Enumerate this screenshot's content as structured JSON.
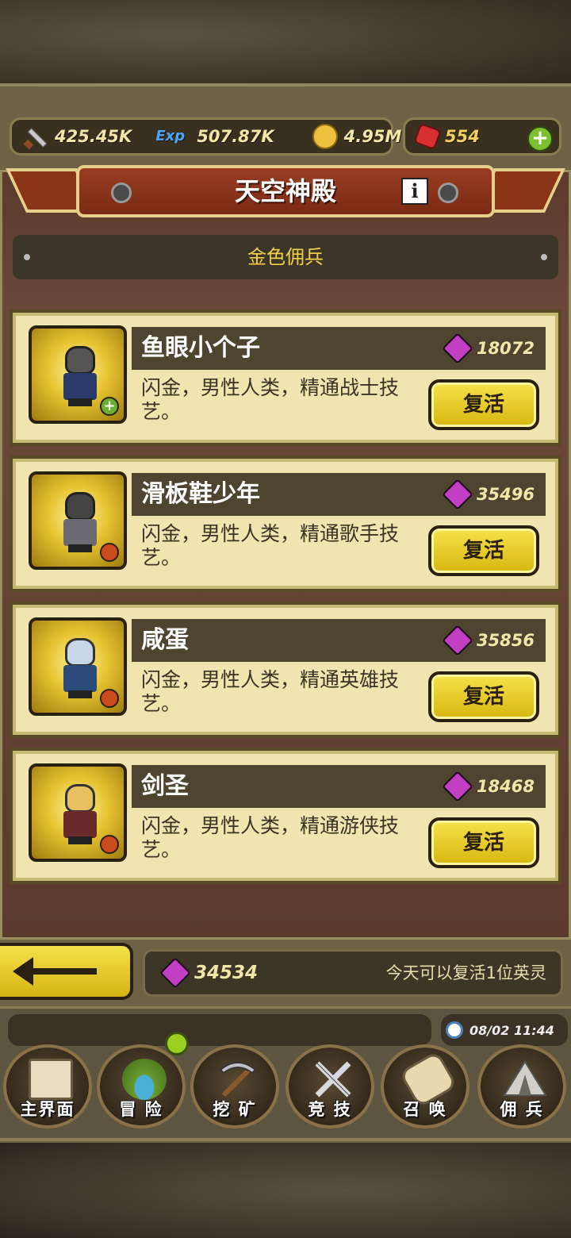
{
  "resources": {
    "attack": "425.45K",
    "exp_label": "Exp",
    "exp": "507.87K",
    "gold": "4.95M",
    "rubies": "554"
  },
  "header": {
    "title": "天空神殿",
    "info_label": "i",
    "subtitle": "金色佣兵"
  },
  "heroes": [
    {
      "name": "鱼眼小个子",
      "cost": "18072",
      "desc": "闪金，男性人类，精通战士技艺。",
      "button": "复活",
      "badge": "+"
    },
    {
      "name": "滑板鞋少年",
      "cost": "35496",
      "desc": "闪金，男性人类，精通歌手技艺。",
      "button": "复活",
      "badge": ""
    },
    {
      "name": "咸蛋",
      "cost": "35856",
      "desc": "闪金，男性人类，精通英雄技艺。",
      "button": "复活",
      "badge": ""
    },
    {
      "name": "剑圣",
      "cost": "18468",
      "desc": "闪金，男性人类，精通游侠技艺。",
      "button": "复活",
      "badge": ""
    }
  ],
  "footer": {
    "balance": "34534",
    "revive_note": "今天可以复活1位英灵"
  },
  "status": {
    "datetime": "08/02 11:44"
  },
  "nav": [
    {
      "label": "主界面",
      "icon": "map-scroll-icon"
    },
    {
      "label": "冒 险",
      "icon": "island-icon"
    },
    {
      "label": "挖 矿",
      "icon": "pickaxe-icon"
    },
    {
      "label": "竞 技",
      "icon": "crossed-swords-icon"
    },
    {
      "label": "召 唤",
      "icon": "summon-scroll-icon"
    },
    {
      "label": "佣 兵",
      "icon": "tent-icon"
    }
  ],
  "colors": {
    "accent_yellow": "#f0d048",
    "card_bg": "#f0e5b0",
    "gem_purple": "#c23ec2",
    "ruby_red": "#d83030"
  }
}
